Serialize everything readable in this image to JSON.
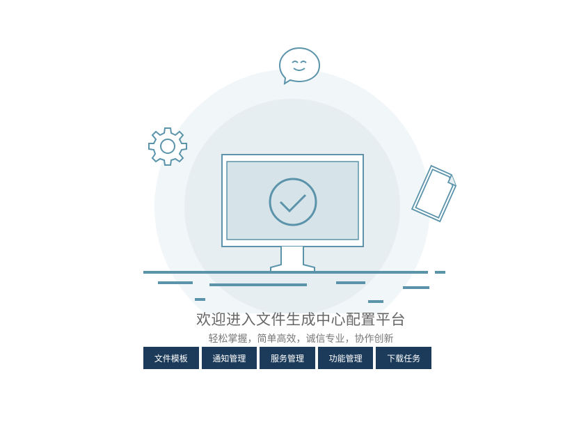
{
  "welcome": {
    "title": "欢迎进入文件生成中心配置平台",
    "subtitle": "轻松掌握，简单高效，诚信专业，协作创新"
  },
  "nav": {
    "buttons": [
      {
        "label": "文件模板",
        "name": "file-template-button"
      },
      {
        "label": "通知管理",
        "name": "notification-management-button"
      },
      {
        "label": "服务管理",
        "name": "service-management-button"
      },
      {
        "label": "功能管理",
        "name": "function-management-button"
      },
      {
        "label": "下载任务",
        "name": "download-tasks-button"
      }
    ]
  },
  "colors": {
    "accent": "#5a93aa",
    "button_bg": "#1c3b5a",
    "circle_outer": "#f1f6f8",
    "circle_inner": "#e8eff2",
    "screen_fill": "#d5e2e8"
  },
  "icons": [
    "chat-bubble-smile-icon",
    "gear-icon",
    "document-icon",
    "monitor-icon",
    "checkmark-circle-icon"
  ]
}
